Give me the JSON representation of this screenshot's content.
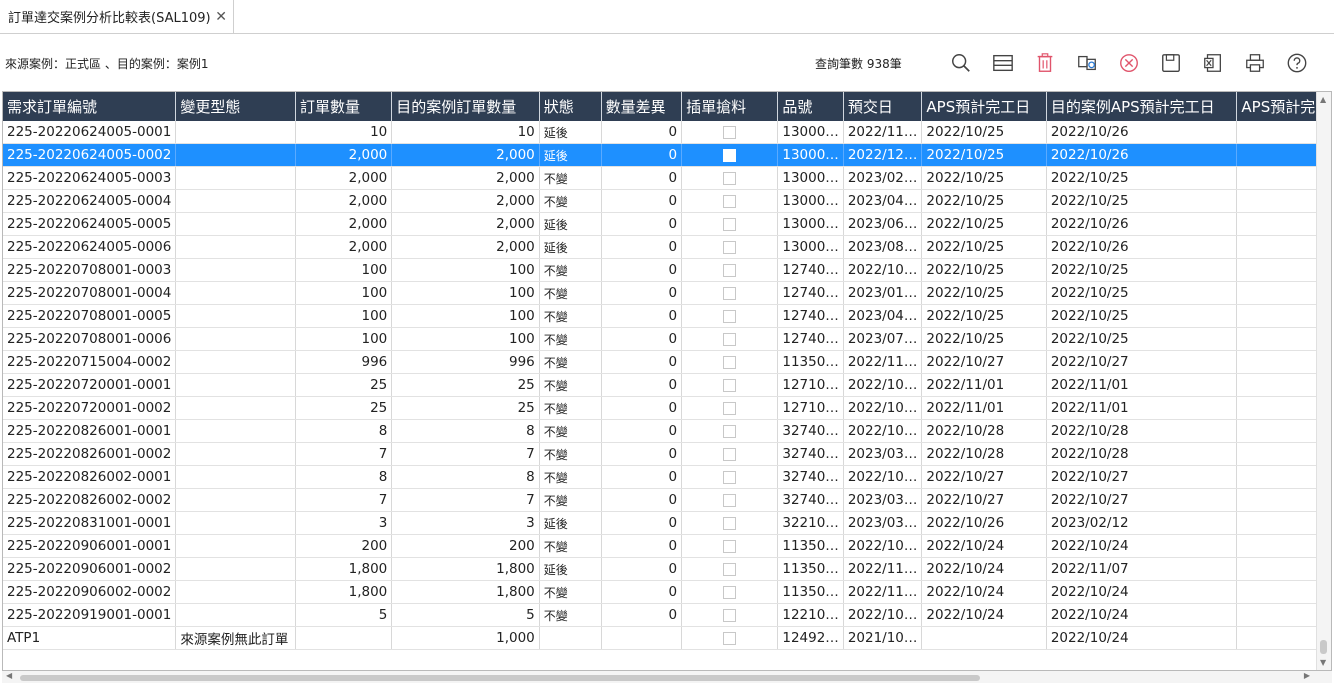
{
  "tab": {
    "title": "訂單達交案例分析比較表(SAL109)",
    "close": "✕"
  },
  "info": {
    "case_text": "來源案例：正式區 、目的案例：案例1",
    "count_text": "查詢筆數 938筆"
  },
  "toolbar": [
    "search-icon",
    "list-icon",
    "delete-icon",
    "compare-icon",
    "cancel-icon",
    "save-icon",
    "excel-icon",
    "print-icon",
    "help-icon"
  ],
  "colors": {
    "header_bg": "#2f3e53",
    "selected_row": "#1e90ff",
    "delete": "#e0546b",
    "cancel": "#e0546b"
  },
  "columns": [
    "需求訂單編號",
    "變更型態",
    "訂單數量",
    "目的案例訂單數量",
    "狀態",
    "數量差異",
    "插單搶料",
    "品號",
    "預交日",
    "APS預計完工日",
    "目的案例APS預計完工日",
    "APS預計完"
  ],
  "rows": [
    {
      "id": "225-20220624005-0001",
      "type": "",
      "qty": "10",
      "target_qty": "10",
      "status": "延後",
      "diff": "0",
      "item": "13000…",
      "due": "2022/11…",
      "aps": "2022/10/25",
      "target_aps": "2022/10/26"
    },
    {
      "id": "225-20220624005-0002",
      "type": "",
      "qty": "2,000",
      "target_qty": "2,000",
      "status": "延後",
      "diff": "0",
      "item": "13000…",
      "due": "2022/12…",
      "aps": "2022/10/25",
      "target_aps": "2022/10/26"
    },
    {
      "id": "225-20220624005-0003",
      "type": "",
      "qty": "2,000",
      "target_qty": "2,000",
      "status": "不變",
      "diff": "0",
      "item": "13000…",
      "due": "2023/02…",
      "aps": "2022/10/25",
      "target_aps": "2022/10/25"
    },
    {
      "id": "225-20220624005-0004",
      "type": "",
      "qty": "2,000",
      "target_qty": "2,000",
      "status": "不變",
      "diff": "0",
      "item": "13000…",
      "due": "2023/04…",
      "aps": "2022/10/25",
      "target_aps": "2022/10/25"
    },
    {
      "id": "225-20220624005-0005",
      "type": "",
      "qty": "2,000",
      "target_qty": "2,000",
      "status": "延後",
      "diff": "0",
      "item": "13000…",
      "due": "2023/06…",
      "aps": "2022/10/25",
      "target_aps": "2022/10/26"
    },
    {
      "id": "225-20220624005-0006",
      "type": "",
      "qty": "2,000",
      "target_qty": "2,000",
      "status": "延後",
      "diff": "0",
      "item": "13000…",
      "due": "2023/08…",
      "aps": "2022/10/25",
      "target_aps": "2022/10/26"
    },
    {
      "id": "225-20220708001-0003",
      "type": "",
      "qty": "100",
      "target_qty": "100",
      "status": "不變",
      "diff": "0",
      "item": "12740…",
      "due": "2022/10…",
      "aps": "2022/10/25",
      "target_aps": "2022/10/25"
    },
    {
      "id": "225-20220708001-0004",
      "type": "",
      "qty": "100",
      "target_qty": "100",
      "status": "不變",
      "diff": "0",
      "item": "12740…",
      "due": "2023/01…",
      "aps": "2022/10/25",
      "target_aps": "2022/10/25"
    },
    {
      "id": "225-20220708001-0005",
      "type": "",
      "qty": "100",
      "target_qty": "100",
      "status": "不變",
      "diff": "0",
      "item": "12740…",
      "due": "2023/04…",
      "aps": "2022/10/25",
      "target_aps": "2022/10/25"
    },
    {
      "id": "225-20220708001-0006",
      "type": "",
      "qty": "100",
      "target_qty": "100",
      "status": "不變",
      "diff": "0",
      "item": "12740…",
      "due": "2023/07…",
      "aps": "2022/10/25",
      "target_aps": "2022/10/25"
    },
    {
      "id": "225-20220715004-0002",
      "type": "",
      "qty": "996",
      "target_qty": "996",
      "status": "不變",
      "diff": "0",
      "item": "11350…",
      "due": "2022/11…",
      "aps": "2022/10/27",
      "target_aps": "2022/10/27"
    },
    {
      "id": "225-20220720001-0001",
      "type": "",
      "qty": "25",
      "target_qty": "25",
      "status": "不變",
      "diff": "0",
      "item": "12710…",
      "due": "2022/10…",
      "aps": "2022/11/01",
      "target_aps": "2022/11/01"
    },
    {
      "id": "225-20220720001-0002",
      "type": "",
      "qty": "25",
      "target_qty": "25",
      "status": "不變",
      "diff": "0",
      "item": "12710…",
      "due": "2022/10…",
      "aps": "2022/11/01",
      "target_aps": "2022/11/01"
    },
    {
      "id": "225-20220826001-0001",
      "type": "",
      "qty": "8",
      "target_qty": "8",
      "status": "不變",
      "diff": "0",
      "item": "32740…",
      "due": "2022/10…",
      "aps": "2022/10/28",
      "target_aps": "2022/10/28"
    },
    {
      "id": "225-20220826001-0002",
      "type": "",
      "qty": "7",
      "target_qty": "7",
      "status": "不變",
      "diff": "0",
      "item": "32740…",
      "due": "2023/03…",
      "aps": "2022/10/28",
      "target_aps": "2022/10/28"
    },
    {
      "id": "225-20220826002-0001",
      "type": "",
      "qty": "8",
      "target_qty": "8",
      "status": "不變",
      "diff": "0",
      "item": "32740…",
      "due": "2022/10…",
      "aps": "2022/10/27",
      "target_aps": "2022/10/27"
    },
    {
      "id": "225-20220826002-0002",
      "type": "",
      "qty": "7",
      "target_qty": "7",
      "status": "不變",
      "diff": "0",
      "item": "32740…",
      "due": "2023/03…",
      "aps": "2022/10/27",
      "target_aps": "2022/10/27"
    },
    {
      "id": "225-20220831001-0001",
      "type": "",
      "qty": "3",
      "target_qty": "3",
      "status": "延後",
      "diff": "0",
      "item": "32210…",
      "due": "2023/03…",
      "aps": "2022/10/26",
      "target_aps": "2023/02/12"
    },
    {
      "id": "225-20220906001-0001",
      "type": "",
      "qty": "200",
      "target_qty": "200",
      "status": "不變",
      "diff": "0",
      "item": "11350…",
      "due": "2022/10…",
      "aps": "2022/10/24",
      "target_aps": "2022/10/24"
    },
    {
      "id": "225-20220906001-0002",
      "type": "",
      "qty": "1,800",
      "target_qty": "1,800",
      "status": "延後",
      "diff": "0",
      "item": "11350…",
      "due": "2022/11…",
      "aps": "2022/10/24",
      "target_aps": "2022/11/07"
    },
    {
      "id": "225-20220906002-0002",
      "type": "",
      "qty": "1,800",
      "target_qty": "1,800",
      "status": "不變",
      "diff": "0",
      "item": "11350…",
      "due": "2022/11…",
      "aps": "2022/10/24",
      "target_aps": "2022/10/24"
    },
    {
      "id": "225-20220919001-0001",
      "type": "",
      "qty": "5",
      "target_qty": "5",
      "status": "不變",
      "diff": "0",
      "item": "12210…",
      "due": "2022/10…",
      "aps": "2022/10/24",
      "target_aps": "2022/10/24"
    },
    {
      "id": "ATP1",
      "type": "來源案例無此訂單",
      "qty": "",
      "target_qty": "1,000",
      "status": "",
      "diff": "",
      "item": "12492…",
      "due": "2021/10…",
      "aps": "",
      "target_aps": "2022/10/24"
    }
  ],
  "selected_row": 1
}
